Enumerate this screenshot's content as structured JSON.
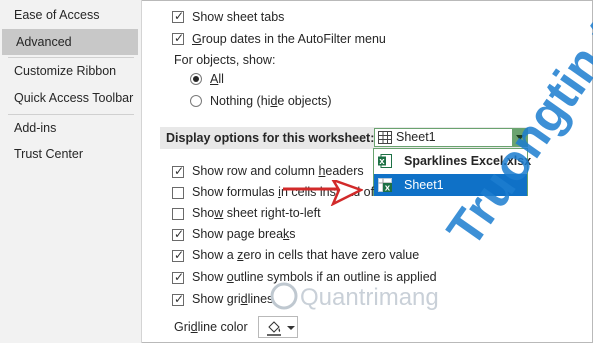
{
  "sidebar": {
    "items": [
      {
        "label": "Ease of Access"
      },
      {
        "label": "Advanced"
      },
      {
        "label": "Customize Ribbon"
      },
      {
        "label": "Quick Access Toolbar"
      },
      {
        "label": "Add-ins"
      },
      {
        "label": "Trust Center"
      }
    ],
    "selected": "Advanced"
  },
  "top_options": {
    "show_sheet_tabs": {
      "label": "Show sheet tabs",
      "checked": true
    },
    "group_dates": {
      "label_pre": "",
      "label_u": "G",
      "label_post": "roup dates in the AutoFilter menu",
      "checked": true
    }
  },
  "objects": {
    "label": "For objects, show:",
    "all": {
      "label_u": "A",
      "label_post": "ll",
      "selected": true
    },
    "nothing": {
      "label_pre": "Nothing (hi",
      "label_u": "d",
      "label_post": "e objects)",
      "selected": false
    }
  },
  "worksheet_section": {
    "title": "Display options for this worksheet:",
    "selected_value": "Sheet1",
    "dropdown": {
      "workbook": "Sparklines Excel.xlsx",
      "sheet": "Sheet1"
    }
  },
  "worksheet_options": [
    {
      "pre": "Show row and column ",
      "u": "h",
      "post": "eaders",
      "checked": true
    },
    {
      "pre": "Show formulas ",
      "u": "i",
      "post": "n cells instead of",
      "checked": false
    },
    {
      "pre": "Sho",
      "u": "w",
      "post": " sheet right-to-left",
      "checked": false
    },
    {
      "pre": "Show page brea",
      "u": "k",
      "post": "s",
      "checked": true
    },
    {
      "pre": "Show a ",
      "u": "z",
      "post": "ero in cells that have zero value",
      "checked": true
    },
    {
      "pre": "Show ",
      "u": "o",
      "post": "utline symbols if an outline is applied",
      "checked": true
    },
    {
      "pre": "Show gri",
      "u": "d",
      "post": "lines",
      "checked": true
    }
  ],
  "gridline_color": {
    "pre": "Gri",
    "u": "d",
    "post": "line color"
  },
  "watermark": {
    "text": "Truongtin.top",
    "sub": "Quantrimang"
  },
  "colors": {
    "accent_green": "#6aa36f",
    "highlight_blue": "#0f71c7",
    "watermark_blue": "#1c7dd0",
    "arrow_red": "#d22a2a"
  }
}
